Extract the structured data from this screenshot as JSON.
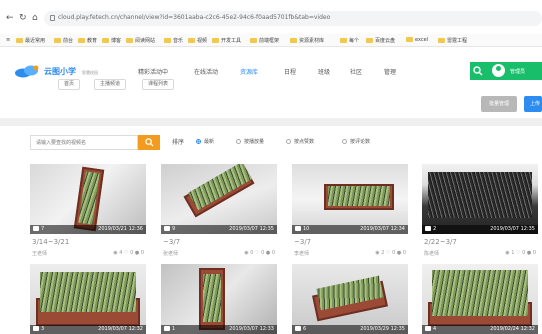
{
  "browser": {
    "url": "cloud.play.fetech.cn/channel/view?id=3601aaba-c2c6-45e2-94c6-f0aad5701fb&tab=video",
    "bookmarks": [
      "最近常用",
      "前台",
      "教育",
      "博客",
      "阅读网站",
      "音乐",
      "视频",
      "开发工具",
      "前端框架",
      "资源素材库",
      "每个",
      "百度云盘",
      "excel",
      "雷霆工程"
    ]
  },
  "header": {
    "logo_text": "云图小学",
    "logo_sub": "智慧校园",
    "menu": [
      "精彩活动中",
      "在线活动",
      "资源库",
      "日程",
      "班级",
      "社区",
      "管理"
    ],
    "active_index": 2,
    "user_name": "管理员"
  },
  "subtabs": [
    "首页",
    "主播频道",
    "课程列表"
  ],
  "actions": {
    "manage": "批量管理",
    "upload": "上传"
  },
  "filter": {
    "search_placeholder": "请输入要查找的视频名",
    "sort_label": "排序",
    "options": [
      "最新",
      "按播放量",
      "按点赞数",
      "按评论数"
    ],
    "selected_index": 0
  },
  "cards": [
    {
      "count": "7",
      "date": "2019/03/21 12:36",
      "title": "3/14~3/21",
      "author": "王老师",
      "views": "4",
      "likes": "0",
      "comments": "0"
    },
    {
      "count": "9",
      "date": "2019/03/07 12:35",
      "title": "~3/7",
      "author": "张老师",
      "views": "0",
      "likes": "0",
      "comments": "0"
    },
    {
      "count": "10",
      "date": "2019/03/07 12:34",
      "title": "~3/7",
      "author": "李老师",
      "views": "2",
      "likes": "0",
      "comments": "0"
    },
    {
      "count": "2",
      "date": "2019/03/07 12:35",
      "title": "2/22~3/7",
      "author": "陈老师",
      "views": "1",
      "likes": "0",
      "comments": "0"
    },
    {
      "count": "3",
      "date": "2019/03/07 12:32",
      "title": "",
      "author": "",
      "views": "",
      "likes": "",
      "comments": ""
    },
    {
      "count": "1",
      "date": "2019/03/07 12:33",
      "title": "",
      "author": "",
      "views": "",
      "likes": "",
      "comments": ""
    },
    {
      "count": "6",
      "date": "2019/03/29 12:35",
      "title": "",
      "author": "",
      "views": "",
      "likes": "",
      "comments": ""
    },
    {
      "count": "4",
      "date": "2019/02/24 12:32",
      "title": "",
      "author": "",
      "views": "",
      "likes": "",
      "comments": ""
    }
  ]
}
